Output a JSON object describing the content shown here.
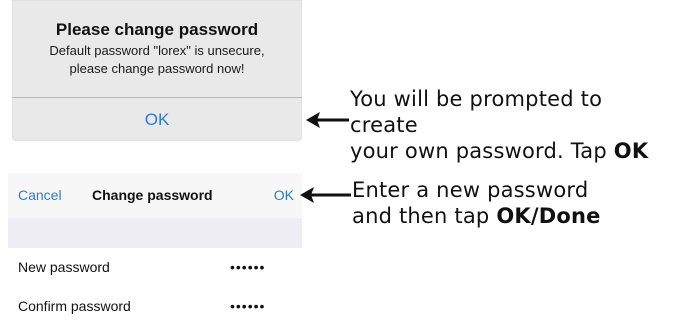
{
  "alert": {
    "title": "Please change password",
    "message_line1": "Default password \"lorex\" is unsecure,",
    "message_line2": "please change password now!",
    "ok_label": "OK"
  },
  "callouts": {
    "prompt": {
      "line1": "You will be prompted to create",
      "line2_text": "your own password. Tap ",
      "line2_bold": "OK"
    },
    "enter": {
      "line1": "Enter a new password",
      "line2_text": "and then tap ",
      "line2_bold": "OK/Done"
    }
  },
  "change_password": {
    "cancel_label": "Cancel",
    "title": "Change password",
    "ok_label": "OK",
    "fields": [
      {
        "label": "New password",
        "value": "••••••"
      },
      {
        "label": "Confirm password",
        "value": "••••••"
      }
    ]
  },
  "colors": {
    "accent": "#2b7bd6",
    "alert_bg": "#e9e9e9",
    "nav_bg": "#f7f7f7",
    "band_bg": "#ededf3"
  },
  "icons": [
    "arrow-left-icon"
  ]
}
